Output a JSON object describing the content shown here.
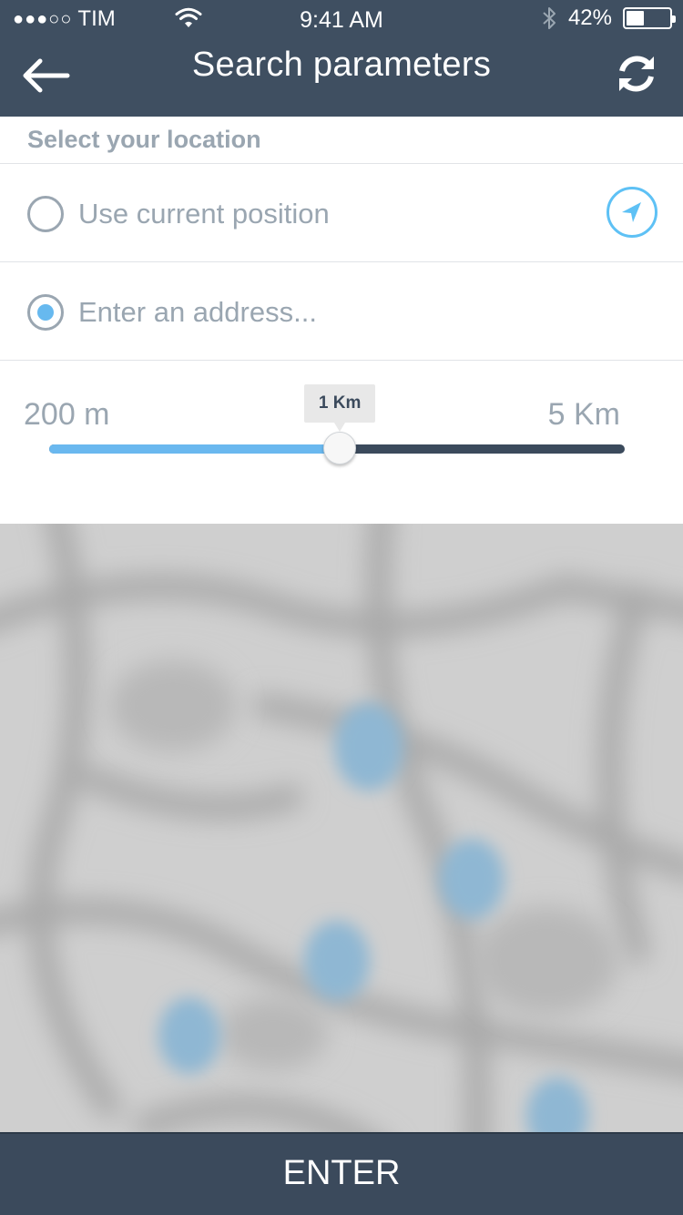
{
  "status_bar": {
    "carrier": "TIM",
    "time": "9:41 AM",
    "battery": "42%",
    "battery_level": 0.42
  },
  "header": {
    "title": "Search parameters",
    "back_icon": "arrow-left-icon",
    "refresh_icon": "refresh-icon"
  },
  "location": {
    "section_label": "Select your location",
    "options": [
      {
        "label": "Use current position",
        "selected": false
      },
      {
        "label": "Enter an address...",
        "selected": true
      }
    ],
    "locate_icon": "location-arrow-icon"
  },
  "radius": {
    "min_label": "200 m",
    "max_label": "5 Km",
    "current_label": "1 Km",
    "fraction": 0.505
  },
  "colors": {
    "header_bg": "#3f4f61",
    "accent": "#67b9ef",
    "track_dark": "#3b4a5c",
    "muted_text": "#9aa6b1"
  },
  "actions": {
    "enter_label": "ENTER"
  }
}
